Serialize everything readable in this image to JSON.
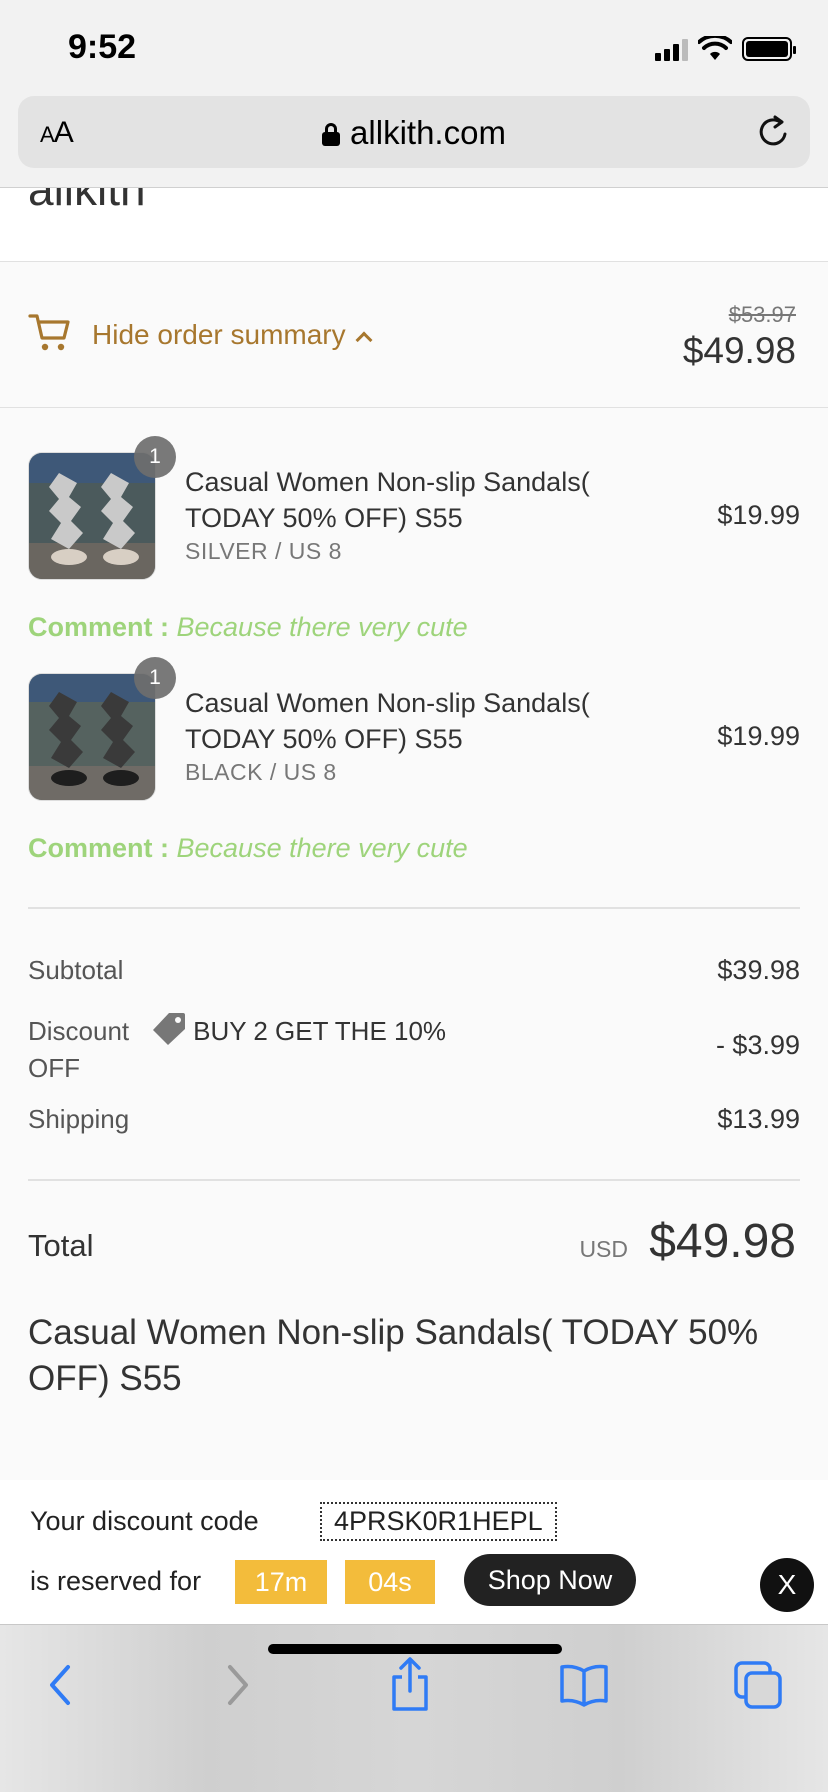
{
  "status_bar": {
    "time": "9:52"
  },
  "browser": {
    "aa_small": "A",
    "aa_large": "A",
    "url": "allkith.com"
  },
  "store": {
    "logo": "allkith"
  },
  "summary": {
    "toggle_label": "Hide order summary",
    "original_total": "$53.97",
    "total": "$49.98"
  },
  "items": [
    {
      "qty": "1",
      "title": "Casual Women Non-slip Sandals( TODAY 50% OFF) S55",
      "variant": "SILVER / US 8",
      "price": "$19.99",
      "comment_label": "Comment :",
      "comment_text": "Because there very cute",
      "strap_color": "#c9c9c9"
    },
    {
      "qty": "1",
      "title": "Casual Women Non-slip Sandals( TODAY 50% OFF) S55",
      "variant": "BLACK / US 8",
      "price": "$19.99",
      "comment_label": "Comment :",
      "comment_text": "Because there very cute",
      "strap_color": "#3a3a3a"
    }
  ],
  "costs": {
    "subtotal_label": "Subtotal",
    "subtotal": "$39.98",
    "discount_label_1": "Discount",
    "discount_label_2": "OFF",
    "discount_code": "BUY 2 GET THE 10%",
    "discount": "- $3.99",
    "shipping_label": "Shipping",
    "shipping": "$13.99",
    "total_label": "Total",
    "currency": "USD",
    "total": "$49.98"
  },
  "heading": "Casual Women Non-slip Sandals( TODAY 50% OFF) S55",
  "promo": {
    "line1": "Your discount code",
    "code": "4PRSK0R1HEPL",
    "line2": "is reserved for",
    "minutes": "17m",
    "seconds": "04s",
    "cta": "Shop Now",
    "close": "X"
  },
  "colors": {
    "accent": "#a7772e",
    "comment": "#9ed47b",
    "timer": "#f3bc3b",
    "ios_blue": "#2f7bf5"
  }
}
